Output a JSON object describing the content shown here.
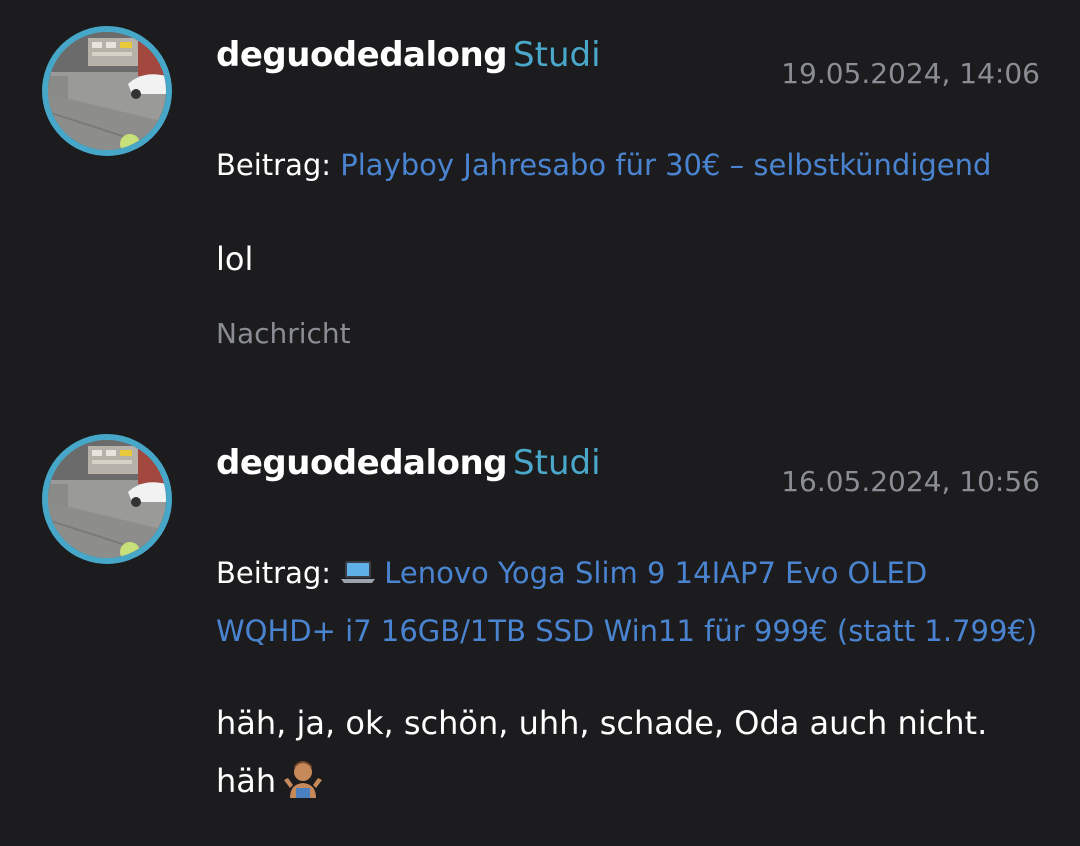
{
  "posts": [
    {
      "author": "deguodedalong",
      "role": "Studi",
      "timestamp": "19.05.2024, 14:06",
      "thread_label": "Beitrag:",
      "thread_title": "Playboy Jahresabo für 30€ – selbstkündigend",
      "message": "lol",
      "meta_label": "Nachricht",
      "avatar_icon": "avatar-photo-parking-lot"
    },
    {
      "author": "deguodedalong",
      "role": "Studi",
      "timestamp": "16.05.2024, 10:56",
      "thread_label": "Beitrag:",
      "thread_icon": "laptop-icon",
      "thread_title": "Lenovo Yoga Slim 9 14IAP7 Evo OLED WQHD+ i7 16GB/1TB SSD Win11 für 999€ (statt 1.799€)",
      "message_line1": "häh, ja, ok, schön, uhh, schade, Oda auch nicht.",
      "message_line2": "häh",
      "message_emoji": "shrug-icon",
      "avatar_icon": "avatar-photo-parking-lot"
    }
  ],
  "colors": {
    "background": "#1c1c1e",
    "link": "#4a84d0",
    "role": "#4aa8ca",
    "avatar_ring": "#46a7c9",
    "muted": "#8a8d93"
  }
}
